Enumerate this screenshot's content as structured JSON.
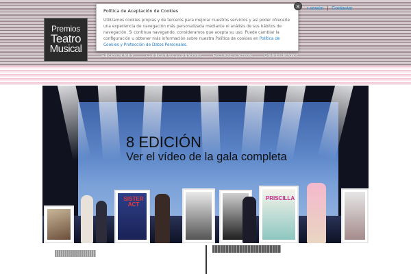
{
  "logo": {
    "line1": "Premios",
    "line2": "Teatro",
    "line3": "Musical"
  },
  "top_links": {
    "login_label": "r sesión",
    "separator": "|",
    "contact_label": "Contactar"
  },
  "nav": {
    "items": [
      {
        "label": "Edición anterior"
      },
      {
        "label": "Candidaturas y ganadores"
      },
      {
        "label": "Escuelas y actores"
      },
      {
        "label": "Galería de fotos"
      }
    ]
  },
  "cookie": {
    "title": "Política de Aceptación de Cookies",
    "text": "Utilizamos cookies propias y de terceros para mejorar nuestros servicios y así poder ofrecerle una experiencia de navegación más personalizada mediante el análisis de sus hábitos de navegación. Si continua navegando, consideramos que acepta su uso. Puede cambiar la configuración u obtener más información sobre nuestra Política de cookies en ",
    "link_label": "Política de Cookies y Protección de Datos Personales",
    "text_end": ".",
    "close_label": "×"
  },
  "hero": {
    "title": "8 EDICIÓN",
    "subtitle": "Ver el vídeo de la gala completa"
  },
  "posters": [
    {
      "label": "SISTER ACT"
    },
    {
      "label": "PRISCILLA"
    }
  ],
  "colors": {
    "accent_link": "#1a8fd6",
    "header_stripe": "#a08c92"
  }
}
